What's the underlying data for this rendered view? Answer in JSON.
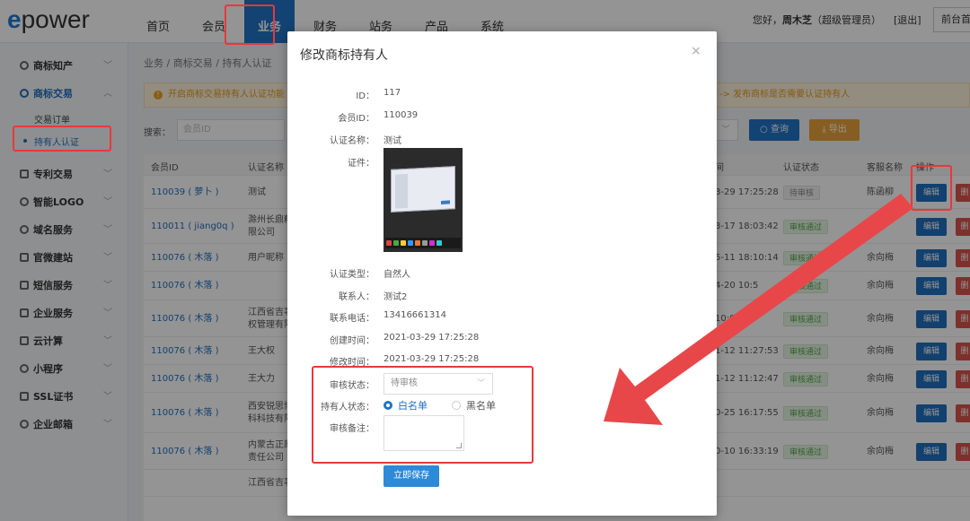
{
  "header": {
    "logo_text": "power",
    "nav": [
      "首页",
      "会员",
      "业务",
      "财务",
      "站务",
      "产品",
      "系统"
    ],
    "active_nav_index": 2,
    "greeting_prefix": "您好，",
    "user_name": "周木芝",
    "user_role": "（超级管理员）",
    "logout": "[退出]",
    "front_button": "前台首"
  },
  "sidebar": {
    "items": [
      {
        "label": "商标知产"
      },
      {
        "label": "商标交易",
        "open": true
      },
      {
        "label": "专利交易"
      },
      {
        "label": "智能LOGO"
      },
      {
        "label": "域名服务"
      },
      {
        "label": "官微建站"
      },
      {
        "label": "短信服务"
      },
      {
        "label": "企业服务"
      },
      {
        "label": "云计算"
      },
      {
        "label": "小程序"
      },
      {
        "label": "SSL证书"
      },
      {
        "label": "企业邮箱"
      }
    ],
    "sub_items": [
      "交易订单",
      "持有人认证"
    ],
    "active_sub_index": 1
  },
  "main": {
    "breadcrumb": "业务 / 商标交易 / 持有人认证",
    "notice_left": "开启商标交易持有人认证功能",
    "notice_right": "-> 发布商标是否需要认证持有人",
    "search_label": "搜索：",
    "search_placeholder": "会员ID",
    "query_button": "查询",
    "export_button": "导出",
    "columns": {
      "member_id": "会员ID",
      "cert_name": "认证名称",
      "time": "间",
      "status": "认证状态",
      "service": "客服名称",
      "action": "操作"
    },
    "rows": [
      {
        "member": "110039 ( 萝卜 )",
        "name": [
          "测试"
        ],
        "time": "3-29 17:25:28",
        "status": "待审核",
        "pending": true,
        "service": "陈函柳"
      },
      {
        "member": "110011 ( jiang0q )",
        "name": [
          "滁州长鼎精",
          "限公司"
        ],
        "time": "3-17 18:03:42",
        "status": "审核通过",
        "pending": false,
        "service": "测试"
      },
      {
        "member": "110076 ( 木落 )",
        "name": [
          "用户昵称"
        ],
        "time": "5-11 18:10:14",
        "status": "审核通过",
        "pending": false,
        "service": "余向梅"
      },
      {
        "member": "110076 ( 木落 )",
        "name": [
          ""
        ],
        "time": "4-20 10:5",
        "status": "审核通过",
        "pending": false,
        "service": "余向梅"
      },
      {
        "member": "110076 ( 木落 )",
        "name": [
          "江西省吉事",
          "权管理有限"
        ],
        "time": "10:08:57",
        "status": "审核通过",
        "pending": false,
        "service": "余向梅"
      },
      {
        "member": "110076 ( 木落 )",
        "name": [
          "王大权"
        ],
        "time": "1-12 11:27:53",
        "status": "审核通过",
        "pending": false,
        "service": "余向梅"
      },
      {
        "member": "110076 ( 木落 )",
        "name": [
          "王大力"
        ],
        "time": "1-12 11:12:47",
        "status": "审核通过",
        "pending": false,
        "service": "余向梅"
      },
      {
        "member": "110076 ( 木落 )",
        "name": [
          "西安锐思博",
          "科科技有限"
        ],
        "time": "0-25 16:17:55",
        "status": "审核通过",
        "pending": false,
        "service": "余向梅"
      },
      {
        "member": "110076 ( 木落 )",
        "name": [
          "内蒙古正原",
          "责任公司"
        ],
        "time": "0-10 16:33:19",
        "status": "审核通过",
        "pending": false,
        "service": "余向梅"
      },
      {
        "member": "",
        "name": [
          "江西省吉事权知识产"
        ],
        "time": "",
        "status": "",
        "pending": false,
        "service": ""
      }
    ],
    "edit_button": "编辑",
    "delete_button": "删"
  },
  "modal": {
    "title": "修改商标持有人",
    "close_icon": "×",
    "fields": [
      {
        "label": "ID：",
        "value": "117"
      },
      {
        "label": "会员ID：",
        "value": "110039"
      },
      {
        "label": "认证名称：",
        "value": "测试"
      },
      {
        "label": "证件：",
        "value": ""
      },
      {
        "label": "认证类型：",
        "value": "自然人"
      },
      {
        "label": "联系人：",
        "value": "测试2"
      },
      {
        "label": "联系电话：",
        "value": "13416661314"
      },
      {
        "label": "创建时间：",
        "value": "2021-03-29 17:25:28"
      },
      {
        "label": "修改时间：",
        "value": "2021-03-29 17:25:28"
      }
    ],
    "review_status_label": "审核状态：",
    "review_status_value": "待审核",
    "holder_status_label": "持有人状态：",
    "holder_options": [
      "白名单",
      "黑名单"
    ],
    "holder_selected": 0,
    "review_note_label": "审核备注：",
    "save_button": "立即保存"
  },
  "colors": {
    "accent": "#1f74c6",
    "highlight": "#e8383d",
    "pass": "#54a64a",
    "danger": "#d9534f"
  }
}
